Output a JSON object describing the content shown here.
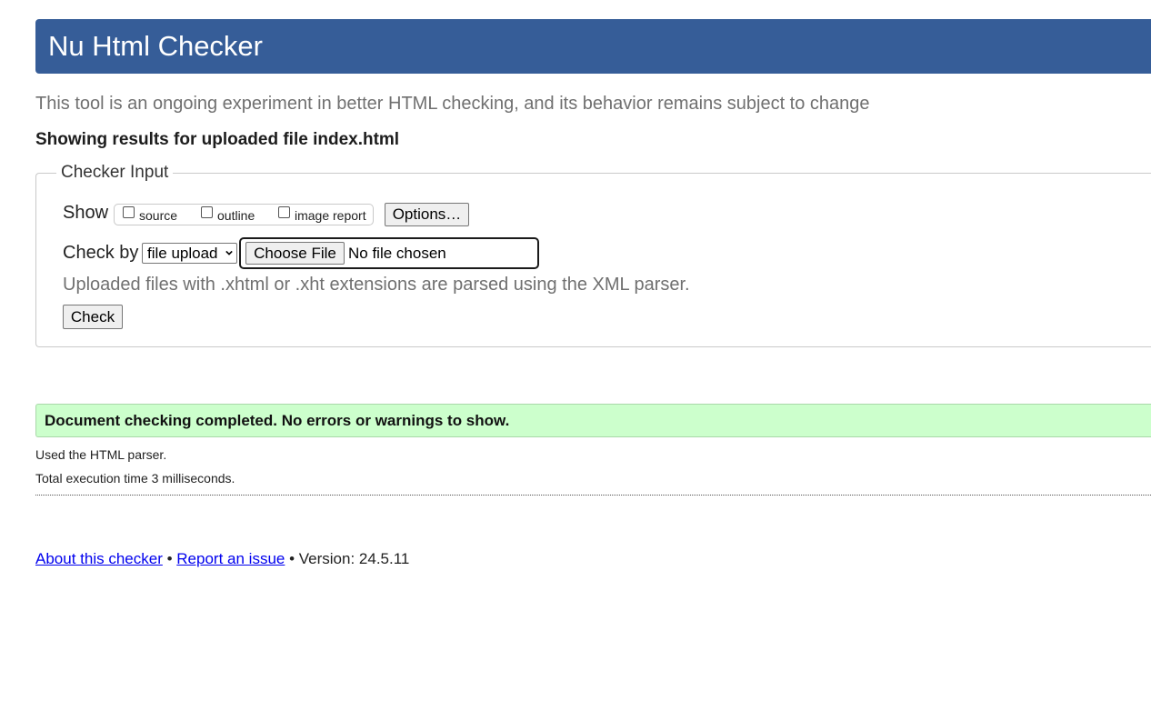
{
  "header": {
    "title": "Nu Html Checker"
  },
  "intro": "This tool is an ongoing experiment in better HTML checking, and its behavior remains subject to change",
  "results_heading": "Showing results for uploaded file index.html",
  "checker_input": {
    "legend": "Checker Input",
    "show_label": "Show",
    "show_options": [
      {
        "label": "source",
        "checked": false
      },
      {
        "label": "outline",
        "checked": false
      },
      {
        "label": "image report",
        "checked": false
      }
    ],
    "options_button": "Options…",
    "check_by_label": "Check by",
    "check_by_selected": "file upload",
    "choose_file_button": "Choose File",
    "file_status": "No file chosen",
    "hint": "Uploaded files with .xhtml or .xht extensions are parsed using the XML parser.",
    "check_button": "Check"
  },
  "result": {
    "success_message": "Document checking completed. No errors or warnings to show.",
    "parser_note": "Used the HTML parser.",
    "execution_time": "Total execution time 3 milliseconds."
  },
  "footer": {
    "about_link": "About this checker",
    "separator": "•",
    "report_link": "Report an issue",
    "version_text": "• Version: 24.5.11"
  },
  "colors": {
    "header_bg": "#365d98",
    "success_bg": "#ccffcc",
    "link": "#0000ee",
    "muted_text": "#707070"
  }
}
